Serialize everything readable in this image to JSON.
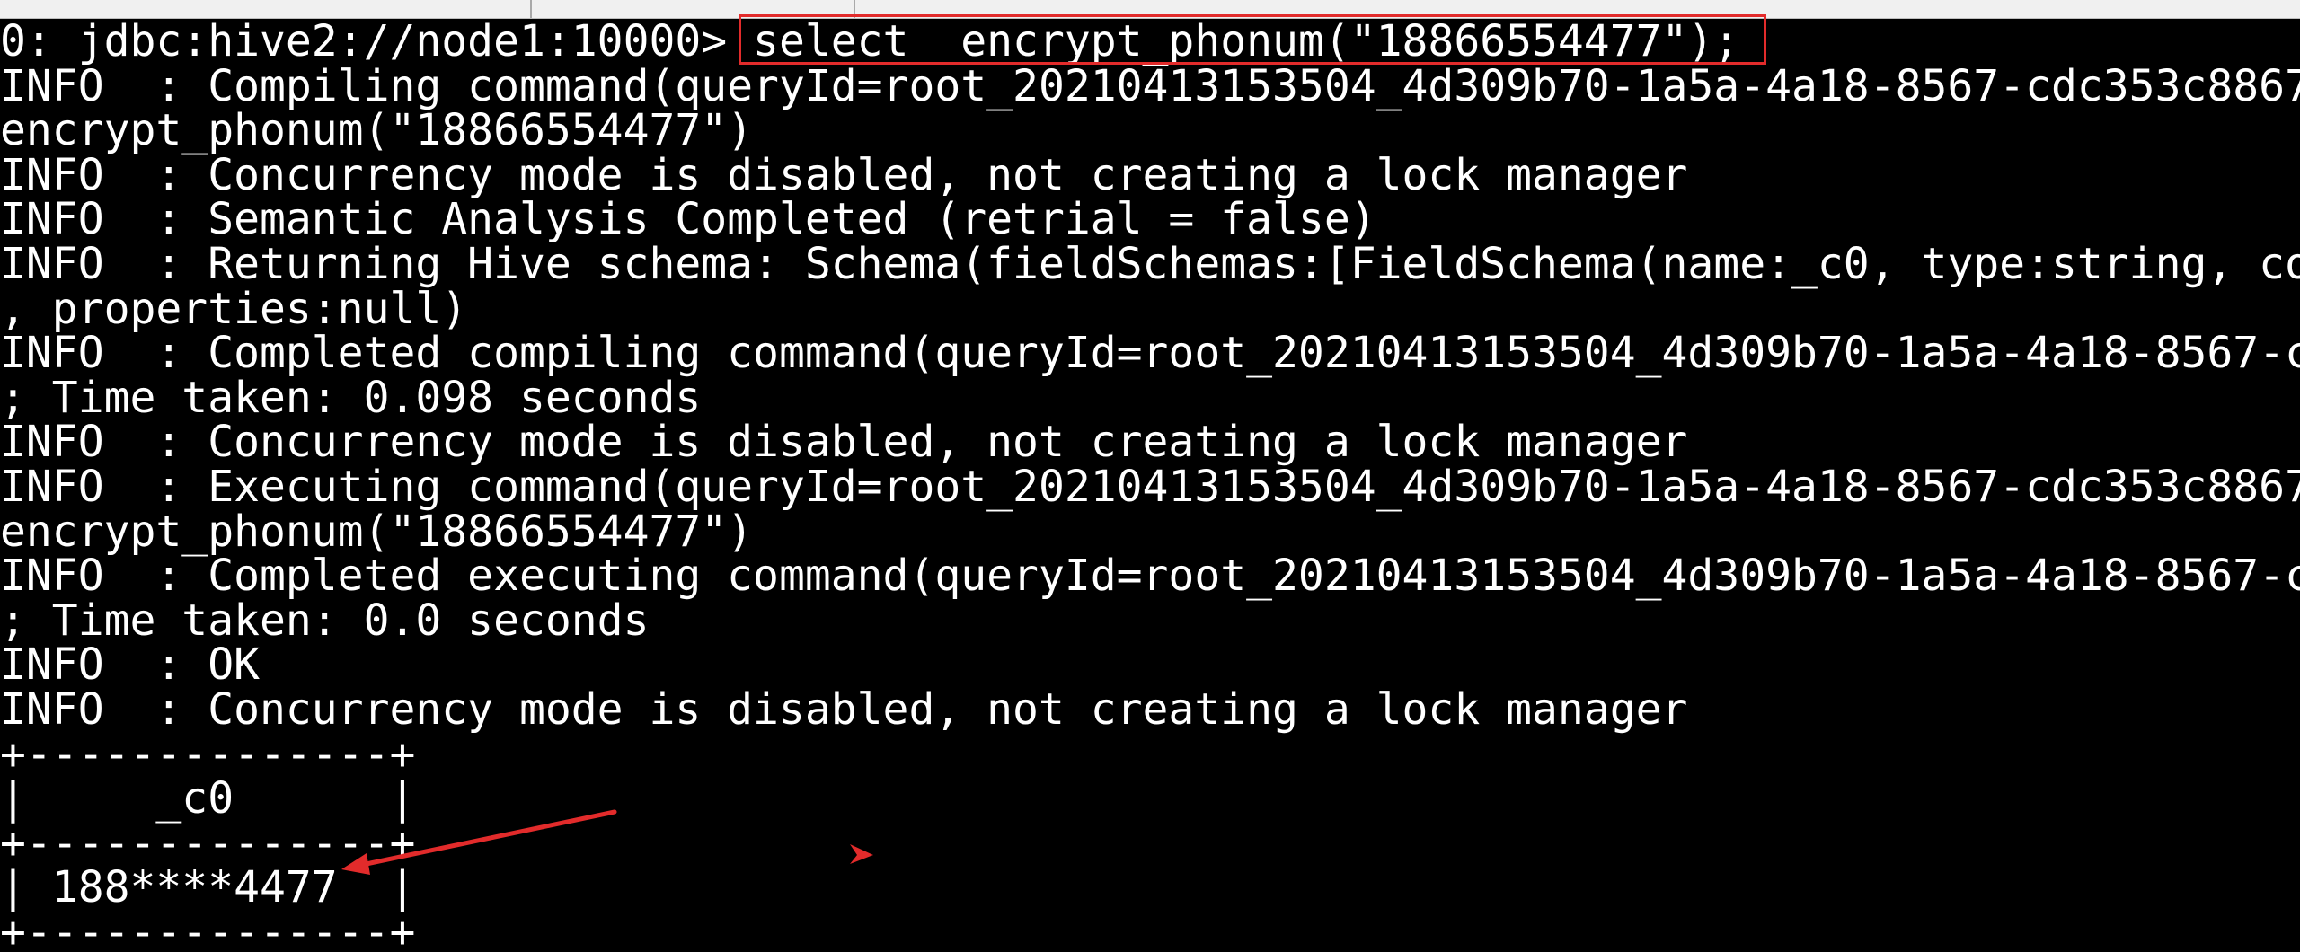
{
  "window": {
    "tabs": [
      "",
      ""
    ]
  },
  "terminal": {
    "lines": [
      "0: jdbc:hive2://node1:10000> select  encrypt_phonum(\"18866554477\");",
      "INFO  : Compiling command(queryId=root_20210413153504_4d309b70-1a5a-4a18-8567-cdc353c8867",
      "encrypt_phonum(\"18866554477\")",
      "INFO  : Concurrency mode is disabled, not creating a lock manager",
      "INFO  : Semantic Analysis Completed (retrial = false)",
      "INFO  : Returning Hive schema: Schema(fieldSchemas:[FieldSchema(name:_c0, type:string, co",
      ", properties:null)",
      "INFO  : Completed compiling command(queryId=root_20210413153504_4d309b70-1a5a-4a18-8567-c",
      "; Time taken: 0.098 seconds",
      "INFO  : Concurrency mode is disabled, not creating a lock manager",
      "INFO  : Executing command(queryId=root_20210413153504_4d309b70-1a5a-4a18-8567-cdc353c8867",
      "encrypt_phonum(\"18866554477\")",
      "INFO  : Completed executing command(queryId=root_20210413153504_4d309b70-1a5a-4a18-8567-c",
      "; Time taken: 0.0 seconds",
      "INFO  : OK",
      "INFO  : Concurrency mode is disabled, not creating a lock manager",
      "+--------------+",
      "|     _c0      |",
      "+--------------+",
      "| 188****4477  |",
      "+--------------+"
    ]
  },
  "annotations": {
    "highlight_color": "#e22b2b"
  }
}
